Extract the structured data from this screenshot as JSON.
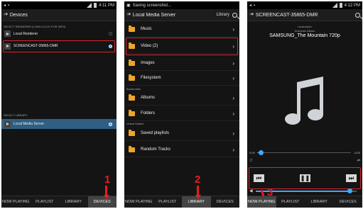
{
  "status": {
    "time1": "4:11 PM",
    "time3": "4:12 PM",
    "notification2": "Saving screenshot..."
  },
  "devices": {
    "title": "Devices",
    "section_renderer": "SELECT RENDERER (LONG-CLICK FOR INFO)",
    "renderers": [
      {
        "label": "Local Renderer",
        "selected": false
      },
      {
        "label": "SCREENCAST-35865-DMR",
        "selected": true
      }
    ],
    "section_library": "SELECT LIBRARY",
    "libraries": [
      {
        "label": "Local Media Server",
        "selected": true
      }
    ]
  },
  "library": {
    "title": "Local Media Server",
    "action": "Library",
    "folders": [
      "Music",
      "Video (2)",
      "Images",
      "Filesystem"
    ],
    "section_bookmarks": "Bookmarks",
    "bookmarks": [
      "Albums",
      "Folders"
    ],
    "section_virtual": "Virtual folders",
    "virtual": [
      "Saved playlists",
      "Random Tracks"
    ]
  },
  "nowplaying": {
    "title": "SCREENCAST-35865-DMR",
    "artist": "<unknown>",
    "album": "Unknown Album",
    "track": "SAMSUNG_The Mountain 720p",
    "elapsed": "0:00",
    "remaining": "-3:00",
    "progress": 0.04,
    "volume": 0.93
  },
  "tabs": [
    "NOW PLAYING",
    "PLAYLIST",
    "LIBRARY",
    "DEVICES"
  ],
  "markers": {
    "m1": "1",
    "m2": "2",
    "m3": "3"
  },
  "colors": {
    "accent": "#3fa9ff",
    "highlight": "#d8262e",
    "folder": "#f0a526"
  }
}
